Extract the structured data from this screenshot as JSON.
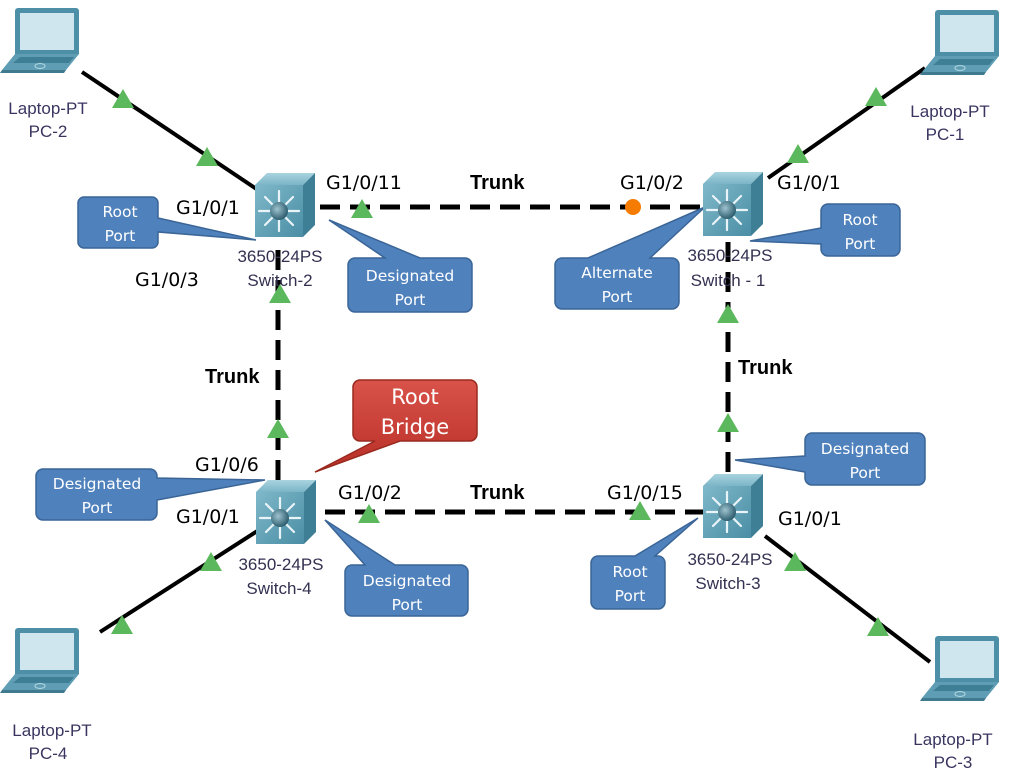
{
  "colors": {
    "callout_blue": "#4f81bd",
    "callout_blue_border": "#3a6596",
    "callout_red": "#c0392b",
    "callout_red_border": "#992a20",
    "link_up_green": "#5cb85c",
    "link_blocked_orange": "#f57c00",
    "switch_teal": "#5a9fb5",
    "laptop_teal": "#4c8fa6"
  },
  "devices": {
    "pc1": {
      "type": "Laptop-PT",
      "name": "PC-1"
    },
    "pc2": {
      "type": "Laptop-PT",
      "name": "PC-2"
    },
    "pc3": {
      "type": "Laptop-PT",
      "name": "PC-3"
    },
    "pc4": {
      "type": "Laptop-PT",
      "name": "PC-4"
    },
    "sw1": {
      "model": "3650-24PS",
      "name": "Switch - 1"
    },
    "sw2": {
      "model": "3650-24PS",
      "name": "Switch-2"
    },
    "sw3": {
      "model": "3650-24PS",
      "name": "Switch-3"
    },
    "sw4": {
      "model": "3650-24PS",
      "name": "Switch-4"
    }
  },
  "ports": {
    "sw2_g101": "G1/0/1",
    "sw2_g1011": "G1/0/11",
    "sw2_g103": "G1/0/3",
    "sw1_g102": "G1/0/2",
    "sw1_g101": "G1/0/1",
    "sw4_g106": "G1/0/6",
    "sw4_g101": "G1/0/1",
    "sw4_g102": "G1/0/2",
    "sw3_g1015": "G1/0/15",
    "sw3_g101": "G1/0/1"
  },
  "links": {
    "top": "Trunk",
    "left": "Trunk",
    "right": "Trunk",
    "bottom": "Trunk"
  },
  "callouts": {
    "sw2_root": {
      "line1": "Root",
      "line2": "Port"
    },
    "sw2_designated": {
      "line1": "Designated",
      "line2": "Port"
    },
    "sw1_alternate": {
      "line1": "Alternate",
      "line2": "Port"
    },
    "sw1_root": {
      "line1": "Root",
      "line2": "Port"
    },
    "root_bridge": {
      "line1": "Root",
      "line2": "Bridge"
    },
    "sw4_designated_left": {
      "line1": "Designated",
      "line2": "Port"
    },
    "sw4_designated_right": {
      "line1": "Designated",
      "line2": "Port"
    },
    "sw3_designated": {
      "line1": "Designated",
      "line2": "Port"
    },
    "sw3_root": {
      "line1": "Root",
      "line2": "Port"
    }
  }
}
